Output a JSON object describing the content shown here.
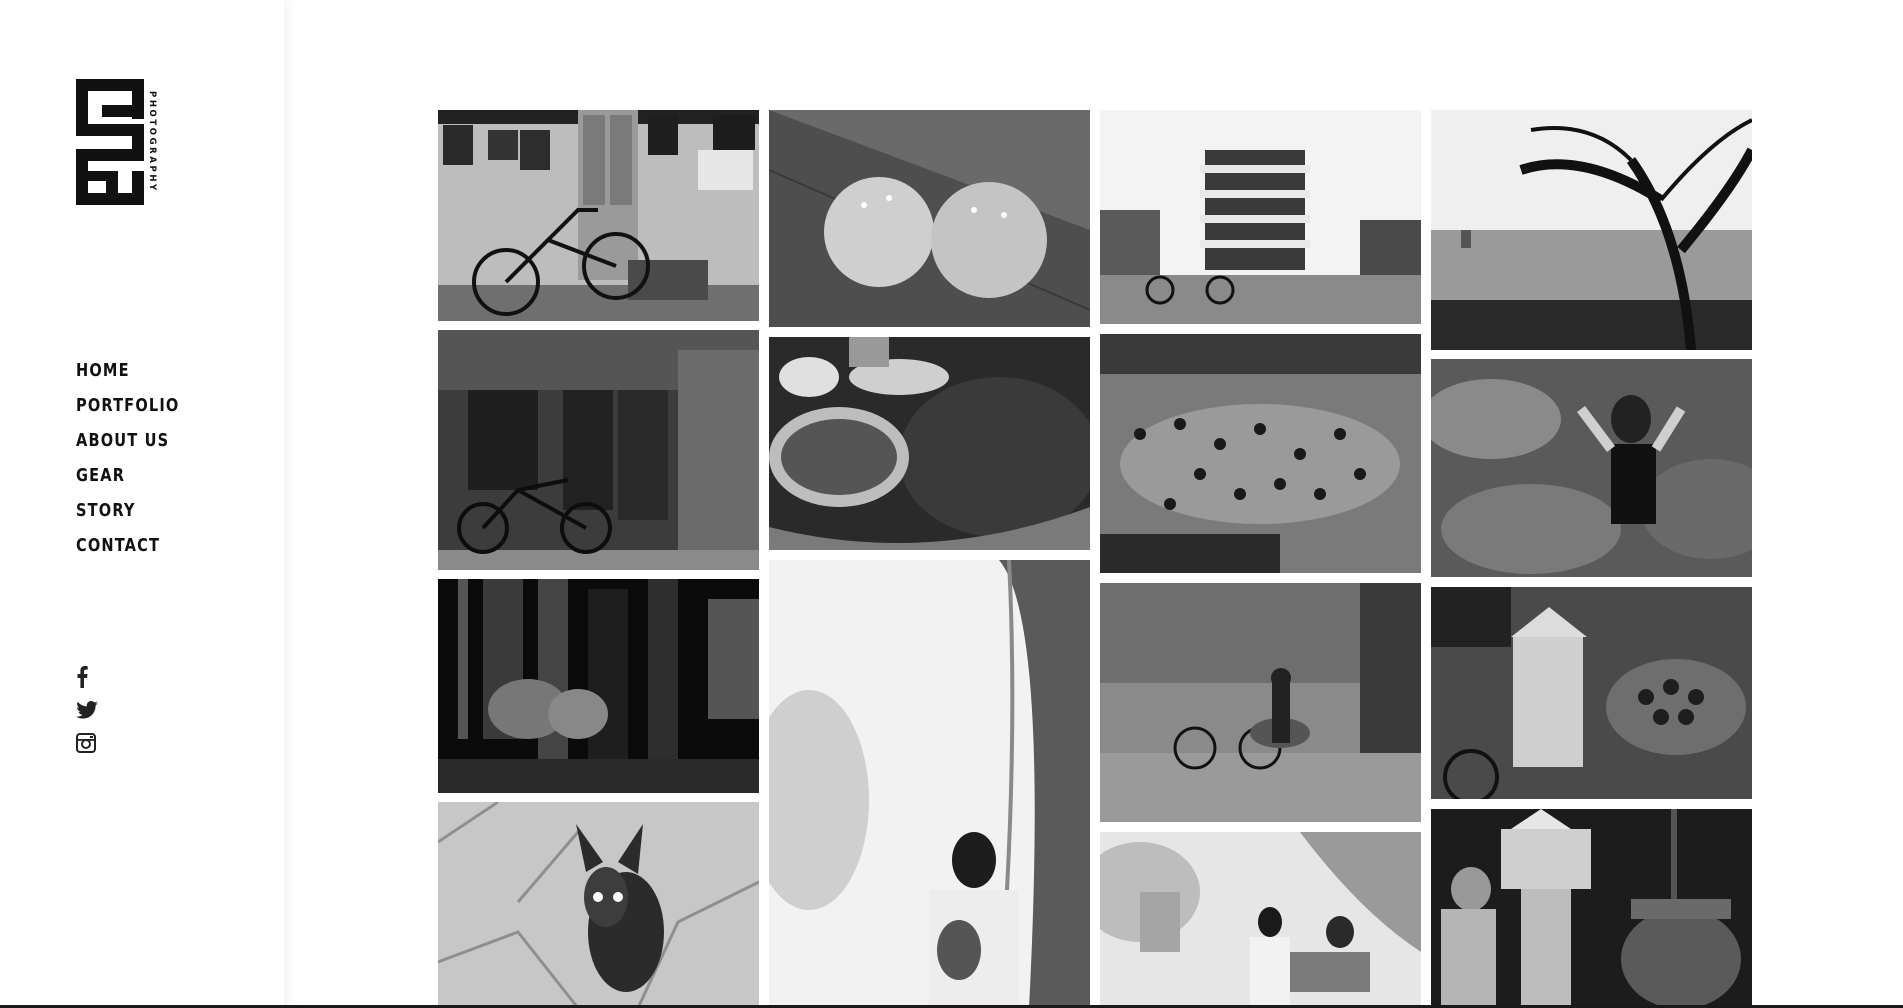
{
  "brand": {
    "logo_name": "PHO logo mark",
    "tagline": "PHOTOGRAPHY"
  },
  "nav": {
    "items": [
      {
        "label": "HOME"
      },
      {
        "label": "PORTFOLIO"
      },
      {
        "label": "ABOUT US"
      },
      {
        "label": "GEAR"
      },
      {
        "label": "STORY"
      },
      {
        "label": "CONTACT"
      }
    ]
  },
  "social": {
    "icons": [
      "facebook-icon",
      "twitter-icon",
      "instagram-icon"
    ]
  },
  "gallery": {
    "photos": [
      {
        "subject": "bicycle against old wall"
      },
      {
        "subject": "two sesame rice balls"
      },
      {
        "subject": "Hanoi street traffic and tower"
      },
      {
        "subject": "tree silhouette by lake"
      },
      {
        "subject": "bicycle by crumbling wall"
      },
      {
        "subject": "market bowls of food"
      },
      {
        "subject": "motorbikes at roundabout"
      },
      {
        "subject": "woman among lotus leaves"
      },
      {
        "subject": "temple interior with people"
      },
      {
        "subject": "woman in white dress by willow"
      },
      {
        "subject": "street vendor with bicycle"
      },
      {
        "subject": "vendor with conical hat and fruit basket"
      },
      {
        "subject": "small dog on stone floor"
      },
      {
        "subject": "couple on bench by lake pagoda"
      },
      {
        "subject": "woman praying at shrine"
      }
    ]
  },
  "colors": {
    "text": "#111111",
    "background": "#ffffff"
  }
}
